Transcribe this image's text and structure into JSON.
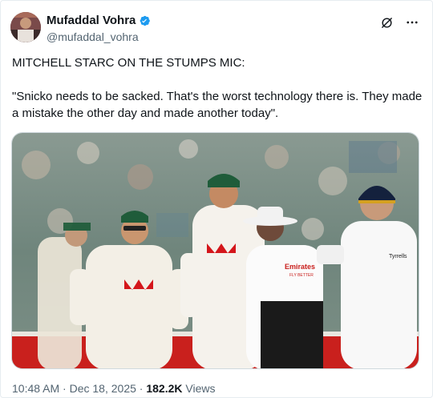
{
  "author": {
    "display_name": "Mufaddal Vohra",
    "handle": "@mufaddal_vohra",
    "verified_color": "#1d9bf0"
  },
  "header_icons": [
    "grok-icon",
    "more-icon"
  ],
  "tweet": {
    "line1": "MITCHELL STARC ON THE STUMPS MIC:",
    "line2": "\"Snicko needs to be sacked. That's the worst technology there is. They made a mistake the other day and made another today\"."
  },
  "media": {
    "jersey_text_umpire": "Emirates",
    "jersey_text_umpire_sub": "FLY BETTER",
    "jersey_text_batter": "Tyrrells"
  },
  "meta": {
    "time": "10:48 AM",
    "separator": "·",
    "date": "Dec 18, 2025",
    "views_count": "182.2K",
    "views_label": "Views"
  },
  "colors": {
    "text": "#0f1419",
    "secondary": "#536471",
    "accent": "#1d9bf0"
  }
}
